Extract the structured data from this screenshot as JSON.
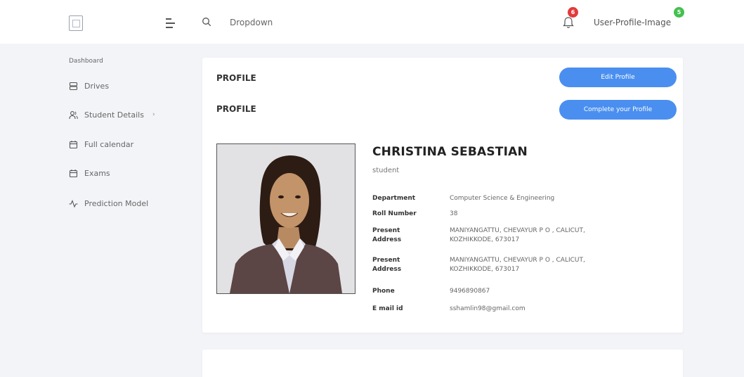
{
  "header": {
    "search_label": "Dropdown",
    "notification_count": "6",
    "profile_label": "User-Profile-Image",
    "profile_badge": "5"
  },
  "sidebar": {
    "section": "Dashboard",
    "items": [
      {
        "label": "Drives",
        "icon": "database-icon"
      },
      {
        "label": "Student Details",
        "icon": "users-icon"
      },
      {
        "label": "Full calendar",
        "icon": "calendar-icon"
      },
      {
        "label": "Exams",
        "icon": "calendar-icon"
      },
      {
        "label": "Prediction Model",
        "icon": "activity-icon"
      }
    ]
  },
  "profile": {
    "title_1": "PROFILE",
    "title_2": "PROFILE",
    "edit_button": "Edit Profile",
    "complete_button": "Complete your Profile",
    "name": "CHRISTINA SEBASTIAN",
    "role": "student",
    "fields": [
      {
        "label": "Department",
        "value": "Computer Science & Engineering"
      },
      {
        "label": "Roll Number",
        "value": "38"
      },
      {
        "label": "Present Address",
        "value": "MANIYANGATTU, CHEVAYUR P O , CALICUT, KOZHIKKODE, 673017"
      },
      {
        "label": "Present Address",
        "value": "MANIYANGATTU, CHEVAYUR P O , CALICUT, KOZHIKKODE, 673017"
      },
      {
        "label": "Phone",
        "value": "9496890867"
      },
      {
        "label": "E mail id",
        "value": "sshamlin98@gmail.com"
      }
    ]
  },
  "colors": {
    "accent": "#4a8ff0",
    "notification_badge": "#e23a3a",
    "profile_badge": "#44c04f"
  }
}
